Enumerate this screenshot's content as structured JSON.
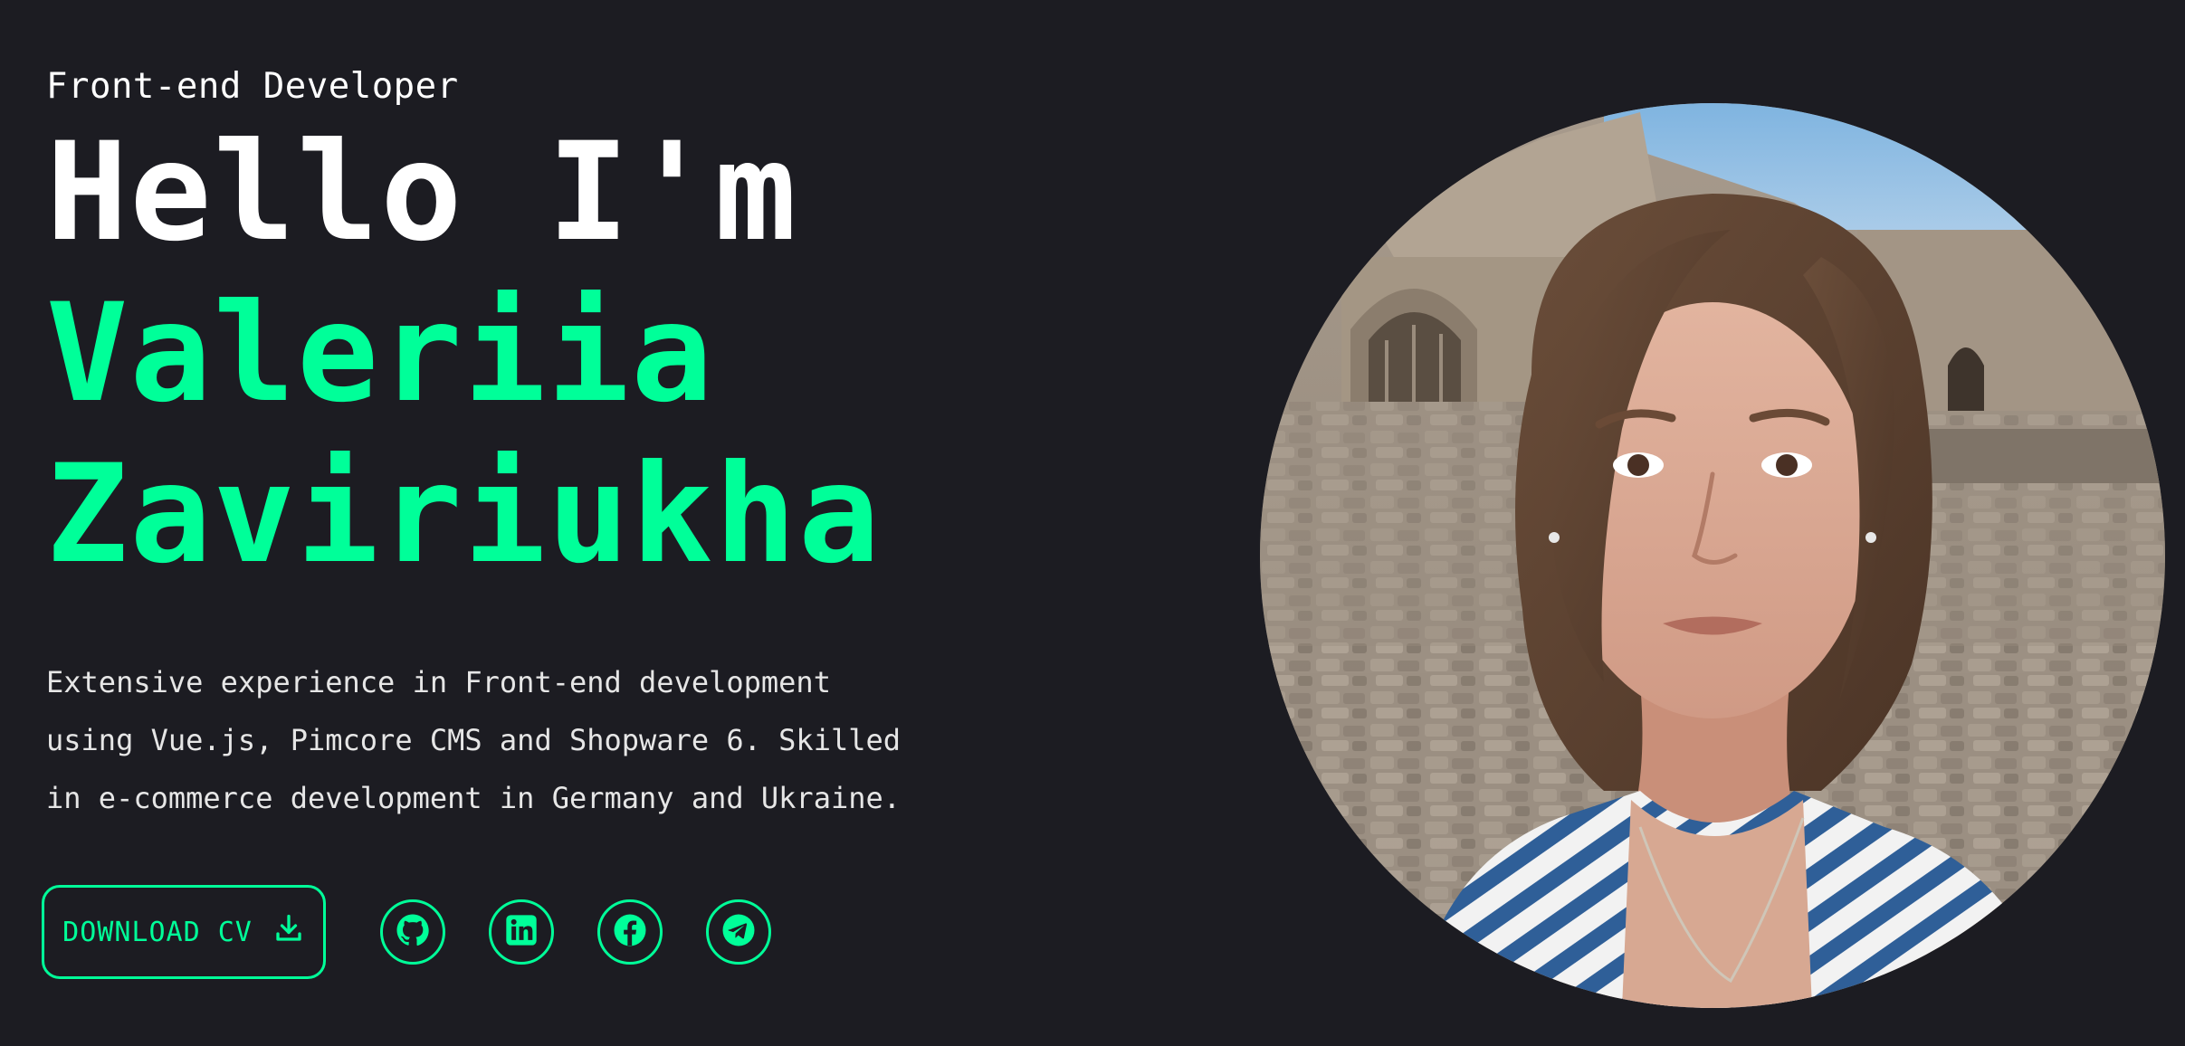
{
  "hero": {
    "role": "Front-end Developer",
    "greeting": "Hello I'm",
    "name_first": "Valeriia",
    "name_last": "Zaviriukha",
    "intro_lines": [
      "Extensive experience in Front-end development",
      "using Vue.js, Pimcore CMS and Shopware 6. Skilled",
      "in e-commerce development in Germany and Ukraine."
    ]
  },
  "actions": {
    "cv_label": "DOWNLOAD CV",
    "cv_icon": "download-icon"
  },
  "socials": [
    {
      "icon": "github-icon"
    },
    {
      "icon": "linkedin-icon"
    },
    {
      "icon": "facebook-icon"
    },
    {
      "icon": "telegram-icon"
    }
  ],
  "colors": {
    "background": "#1c1c22",
    "accent": "#00ff99",
    "text": "#ffffff"
  }
}
